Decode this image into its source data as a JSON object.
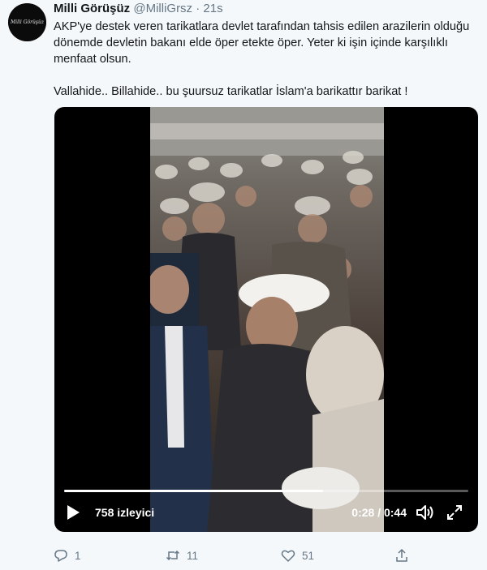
{
  "tweet": {
    "display_name": "Milli Görüşüz",
    "handle": "@MilliGrsz",
    "separator": "·",
    "timestamp": "21s",
    "avatar_text": "Milli Görüşüz",
    "paragraph1": "AKP'ye destek veren tarikatlara devlet tarafından tahsis edilen arazilerin olduğu dönemde devletin bakanı elde öper etekte öper. Yeter ki işin içinde karşılıklı menfaat olsun.",
    "paragraph2": "Vallahide.. Billahide.. bu şuursuz tarikatlar İslam'a barikattır barikat !"
  },
  "video": {
    "view_count": "758 izleyici",
    "timecode": "0:28 / 0:44",
    "progress_fraction": 0.64,
    "play_icon": "play-icon",
    "volume_icon": "volume-icon",
    "fullscreen_icon": "fullscreen-icon"
  },
  "actions": {
    "reply_count": "1",
    "retweet_count": "11",
    "like_count": "51",
    "icons": [
      "reply-icon",
      "retweet-icon",
      "like-icon",
      "share-icon"
    ]
  },
  "colors": {
    "background": "#f5f8fa",
    "text": "#14171a",
    "secondary": "#657786",
    "video_background": "#000000"
  }
}
